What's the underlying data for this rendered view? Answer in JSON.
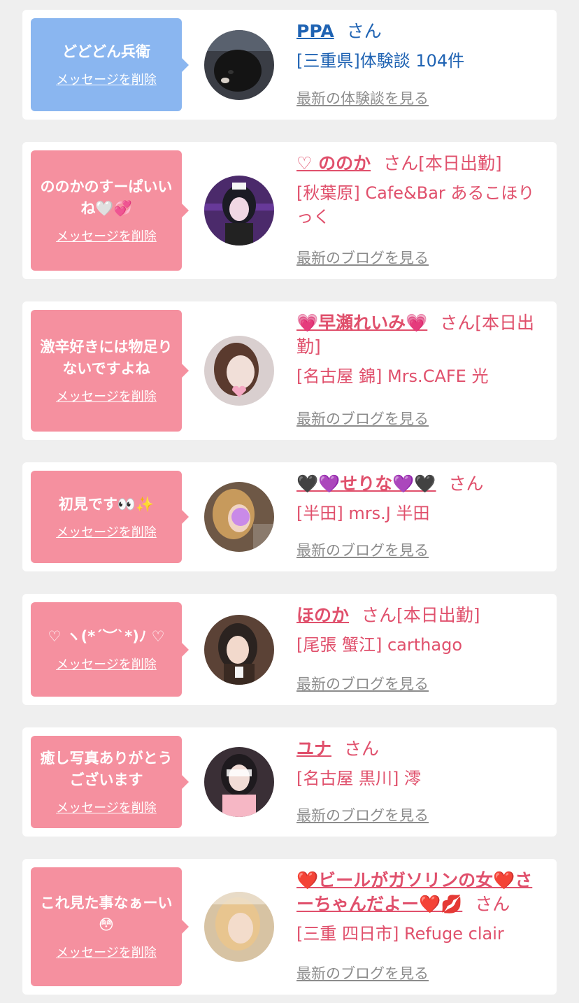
{
  "messages": [
    {
      "bubble_text": "どどどん兵衛",
      "delete_label": "メッセージを削除",
      "name": "PPA",
      "honorific": "さん",
      "badge": "",
      "shop": "[三重県]体験談 104件",
      "latest_label": "最新の体験談を見る",
      "theme": "blue"
    },
    {
      "bubble_text": "ののかのすーぱいいね🤍💞",
      "delete_label": "メッセージを削除",
      "name": "♡ ののか",
      "honorific": "さん",
      "badge": "[本日出勤]",
      "shop": "[秋葉原] Cafe&Bar あるこほりっく",
      "latest_label": "最新のブログを見る",
      "theme": "pink"
    },
    {
      "bubble_text": "激辛好きには物足りないですよね",
      "delete_label": "メッセージを削除",
      "name": "💗早瀬れいみ💗",
      "honorific": "さん",
      "badge": "[本日出勤]",
      "shop": "[名古屋 錦] Mrs.CAFE 光",
      "latest_label": "最新のブログを見る",
      "theme": "pink"
    },
    {
      "bubble_text": "初見です👀✨",
      "delete_label": "メッセージを削除",
      "name": "🖤💜せりな💜🖤",
      "honorific": "さん",
      "badge": "",
      "shop": "[半田] mrs.J 半田",
      "latest_label": "最新のブログを見る",
      "theme": "pink"
    },
    {
      "bubble_text": "♡ ヽ(*´︶`*)ﾉ ♡",
      "delete_label": "メッセージを削除",
      "name": "ほのか",
      "honorific": "さん",
      "badge": "[本日出勤]",
      "shop": "[尾張 蟹江] carthago",
      "latest_label": "最新のブログを見る",
      "theme": "pink"
    },
    {
      "bubble_text": "癒し写真ありがとうございます",
      "delete_label": "メッセージを削除",
      "name": "ユナ",
      "honorific": "さん",
      "badge": "",
      "shop": "[名古屋 黒川] 澪",
      "latest_label": "最新のブログを見る",
      "theme": "pink"
    },
    {
      "bubble_text": "これ見た事なぁーい😳",
      "delete_label": "メッセージを削除",
      "name": "❤️ビールがガソリンの女❤️さーちゃんだよー❤️💋",
      "honorific": "さん",
      "badge": "",
      "shop": "[三重 四日市] Refuge clair",
      "latest_label": "最新のブログを見る",
      "theme": "pink"
    }
  ],
  "avatars": [
    {
      "icon": "dog-avatar-photo",
      "bg": "#3a3d45",
      "fg": "#141414"
    },
    {
      "icon": "girl-avatar-photo",
      "bg": "#4b2a6b",
      "fg": "#f0d8e4"
    },
    {
      "icon": "girl-avatar-photo",
      "bg": "#d9cfcf",
      "fg": "#f4a9c3"
    },
    {
      "icon": "girl-avatar-photo",
      "bg": "#6e5846",
      "fg": "#c98ae8"
    },
    {
      "icon": "girl-avatar-photo",
      "bg": "#5b4236",
      "fg": "#f2d9cc"
    },
    {
      "icon": "girl-avatar-photo",
      "bg": "#3a2f36",
      "fg": "#f6b7c5"
    },
    {
      "icon": "girl-avatar-photo",
      "bg": "#d7c3a3",
      "fg": "#f3dccb"
    }
  ]
}
